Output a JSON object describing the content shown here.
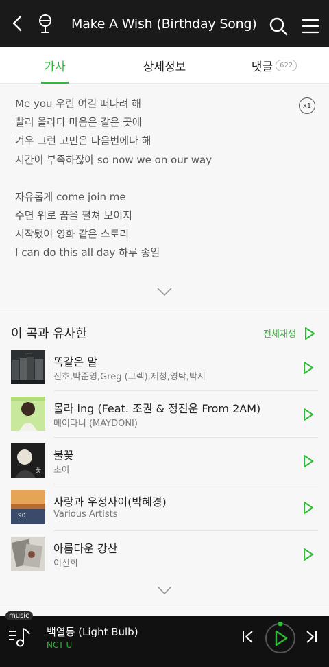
{
  "header": {
    "title": "Make A Wish (Birthday Song)",
    "back_icon": "chevron-left-icon",
    "mic_icon": "microphone-icon",
    "search_icon": "search-icon",
    "menu_icon": "hamburger-menu-icon"
  },
  "tabs": [
    {
      "label": "가사",
      "active": true
    },
    {
      "label": "상세정보",
      "active": false
    },
    {
      "label": "댓글",
      "badge": "622",
      "active": false
    }
  ],
  "lyrics": {
    "lines": [
      "Me you 우린 여길 떠나려 해",
      "빨리 올라타 마음은 같은 곳에",
      "겨우 그런 고민은 다음번에나 해",
      "시간이 부족하잖아 so now we on our way",
      "",
      "자유롭게 come join me",
      "수면 위로 꿈을 펼쳐 보이지",
      "시작됐어 영화 같은 스토리",
      "I can do this all day 하루 종일"
    ],
    "speed_label": "x1"
  },
  "similar": {
    "title": "이 곡과 유사한",
    "play_all_label": "전체재생",
    "songs": [
      {
        "title": "똑같은 말",
        "artist": "진호,박준영,Greg (그렉),제청,영탁,박지"
      },
      {
        "title": "몰라 ing (Feat. 조권 & 정진운 From 2AM)",
        "artist": "메이다니 (MAYDONI)"
      },
      {
        "title": "불꽃",
        "artist": "초아"
      },
      {
        "title": "사랑과 우정사이(박혜경)",
        "artist": "Various Artists"
      },
      {
        "title": "아름다운 강산",
        "artist": "이선희"
      }
    ]
  },
  "player": {
    "tag": "music",
    "title": "백열등 (Light Bulb)",
    "artist": "NCT U"
  },
  "colors": {
    "accent": "#2dbc36",
    "header_bg": "#1a1a1a",
    "player_bg": "#111111"
  }
}
